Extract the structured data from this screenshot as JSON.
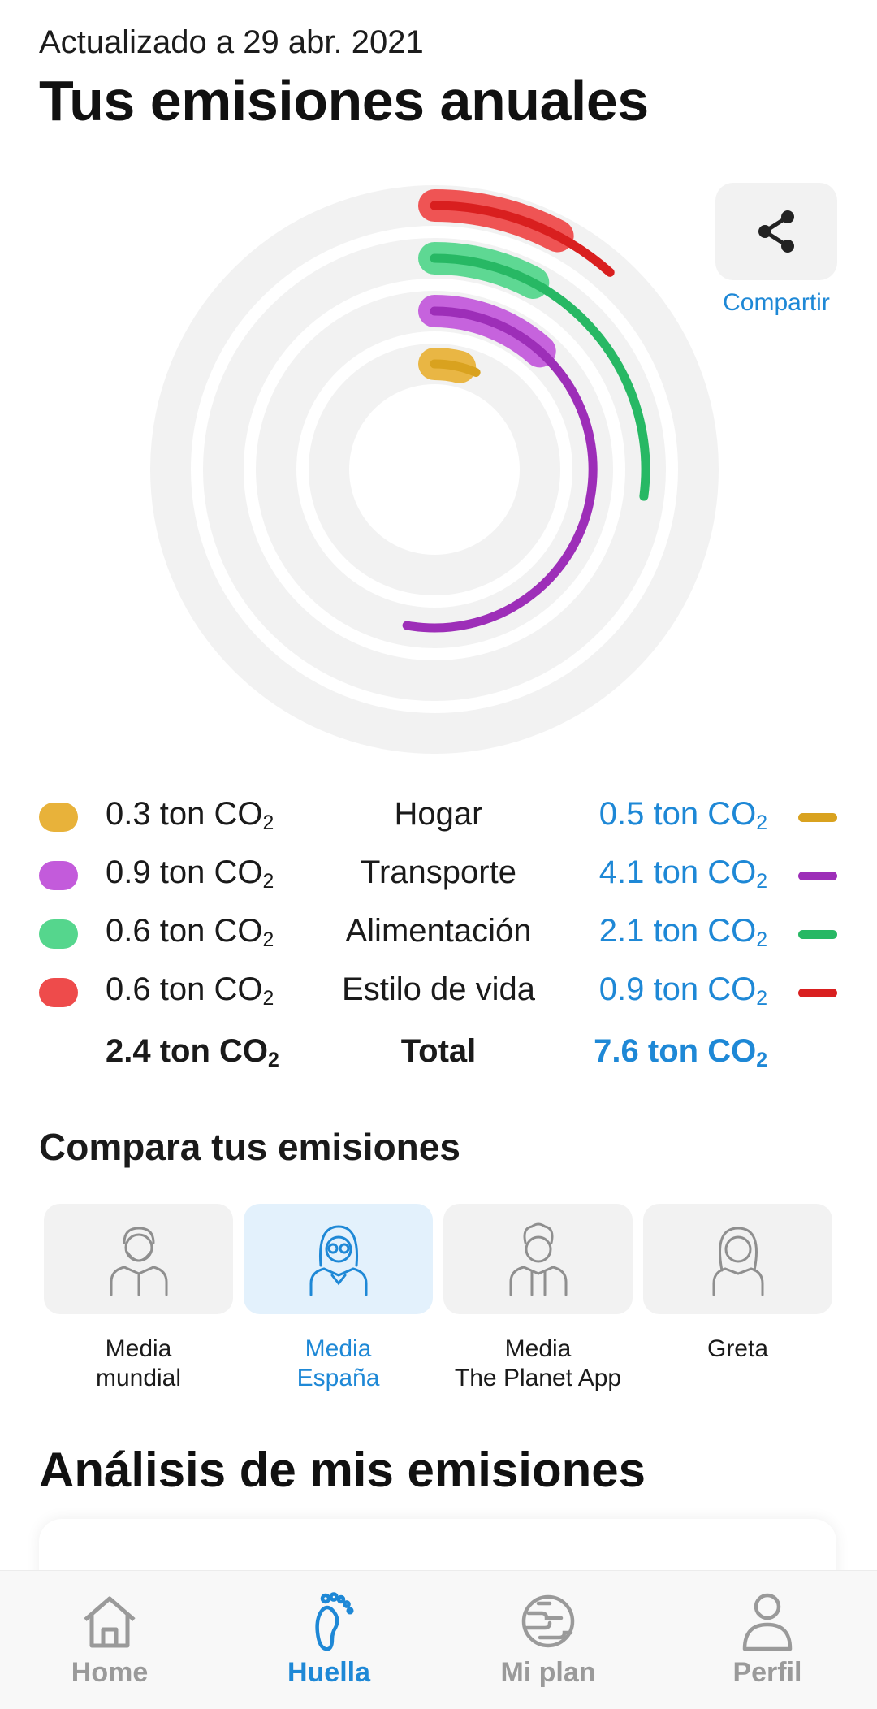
{
  "header": {
    "updated": "Actualizado a 29 abr. 2021",
    "title": "Tus emisiones anuales"
  },
  "share": {
    "label": "Compartir"
  },
  "legend": [
    {
      "mine_value": "0.3 ton CO",
      "category": "Hogar",
      "avg_value": "0.5 ton CO",
      "color": "#E8B23A",
      "avg_color": "#D9A21F"
    },
    {
      "mine_value": "0.9 ton CO",
      "category": "Transporte",
      "avg_value": "4.1 ton CO",
      "color": "#C35BDB",
      "avg_color": "#9D2EB8"
    },
    {
      "mine_value": "0.6 ton CO",
      "category": "Alimentación",
      "avg_value": "2.1 ton CO",
      "color": "#55D68D",
      "avg_color": "#27B864"
    },
    {
      "mine_value": "0.6 ton CO",
      "category": "Estilo de vida",
      "avg_value": "0.9 ton CO",
      "color": "#EE4B4B",
      "avg_color": "#D91F1F"
    }
  ],
  "co2_subscript": "2",
  "totals": {
    "mine": "2.4 ton CO",
    "label": "Total",
    "avg": "7.6 ton CO"
  },
  "compare": {
    "title": "Compara tus emisiones",
    "options": [
      {
        "line1": "Media",
        "line2": "mundial",
        "selected": false
      },
      {
        "line1": "Media",
        "line2": "España",
        "selected": true
      },
      {
        "line1": "Media",
        "line2": "The Planet App",
        "selected": false
      },
      {
        "line1": "Greta",
        "line2": "",
        "selected": false
      }
    ]
  },
  "analysis": {
    "title": "Análisis de mis emisiones"
  },
  "nav": [
    {
      "label": "Home",
      "icon": "home-icon",
      "active": false
    },
    {
      "label": "Huella",
      "icon": "footprint-icon",
      "active": true
    },
    {
      "label": "Mi plan",
      "icon": "planet-icon",
      "active": false
    },
    {
      "label": "Perfil",
      "icon": "profile-icon",
      "active": false
    }
  ],
  "colors": {
    "accent": "#1E88D6",
    "track": "#F2F2F2"
  }
}
